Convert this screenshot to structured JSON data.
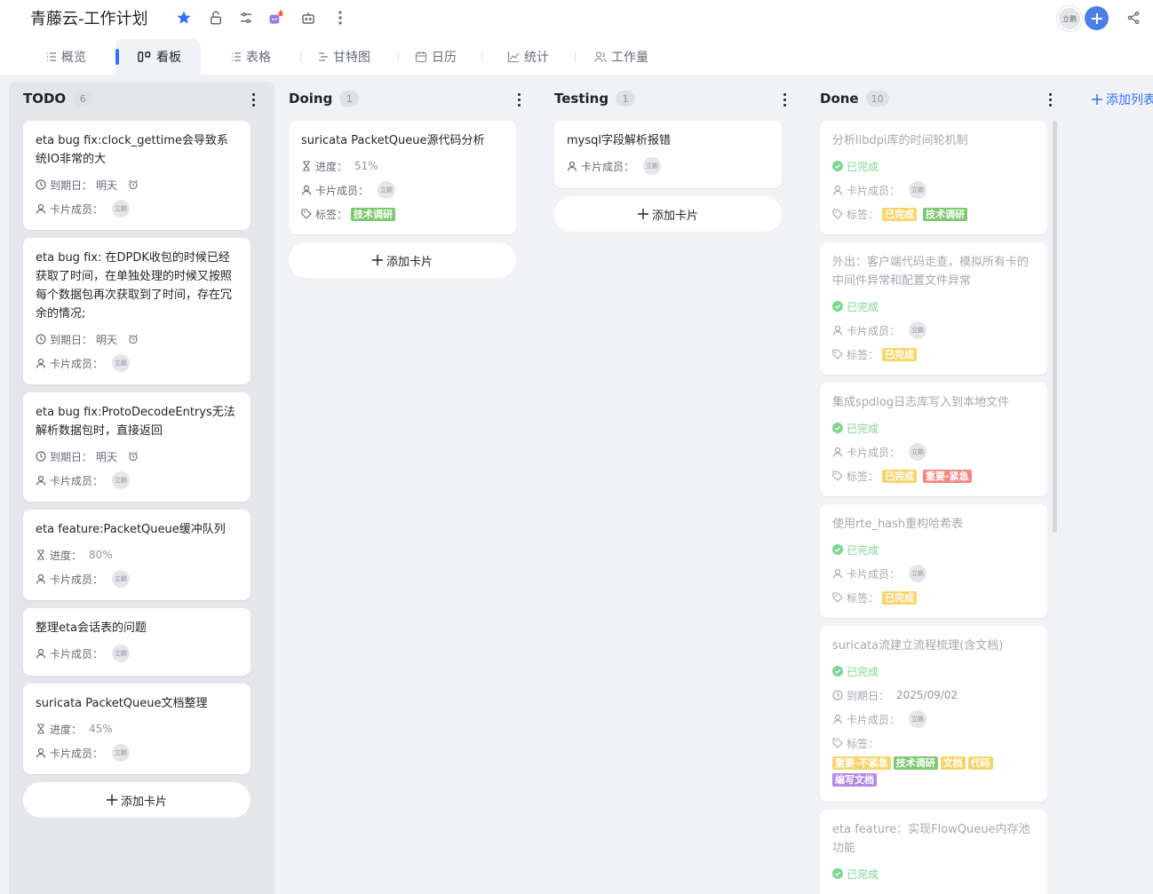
{
  "app": {
    "title": "青藤云-工作计划",
    "header_avatar": "立鹏",
    "accent": "#3370ff"
  },
  "tabs": [
    {
      "label": "概览",
      "icon": "list-icon"
    },
    {
      "label": "看板",
      "icon": "kanban-icon",
      "active": true
    },
    {
      "label": "表格",
      "icon": "list-icon"
    },
    {
      "label": "甘特图",
      "icon": "gantt-icon"
    },
    {
      "label": "日历",
      "icon": "calendar-icon"
    },
    {
      "label": "统计",
      "icon": "chart-icon"
    },
    {
      "label": "工作量",
      "icon": "people-icon"
    }
  ],
  "labels": {
    "due": "到期日：",
    "members": "卡片成员：",
    "progress": "进度：",
    "tags": "标签：",
    "completed": "已完成",
    "add_card": "添加卡片",
    "add_list": "添加列表",
    "tomorrow": "明天",
    "avatar": "立鹏"
  },
  "columns": {
    "todo": {
      "title": "TODO",
      "count": "6",
      "cards": [
        {
          "title": "eta bug fix:clock_gettime会导致系统IO非常的大"
        },
        {
          "title": "eta bug fix: 在DPDK收包的时候已经获取了时间，在单独处理的时候又按照每个数据包再次获取到了时间，存在冗余的情况;"
        },
        {
          "title": "eta bug fix:ProtoDecodeEntrys无法解析数据包时，直接返回"
        },
        {
          "title": "eta feature:PacketQueue缓冲队列",
          "progress": "80%"
        },
        {
          "title": "整理eta会话表的问题"
        },
        {
          "title": "suricata PacketQueue文档整理",
          "progress": "45%"
        }
      ]
    },
    "doing": {
      "title": "Doing",
      "count": "1",
      "cards": [
        {
          "title": "suricata PacketQueue源代码分析",
          "progress": "51%",
          "tags": [
            "技术调研"
          ]
        }
      ]
    },
    "testing": {
      "title": "Testing",
      "count": "1",
      "cards": [
        {
          "title": "mysql字段解析报错"
        }
      ]
    },
    "done": {
      "title": "Done",
      "count": "10",
      "cards": [
        {
          "title": "分析libdpi库的时间轮机制",
          "tags": [
            "已完成",
            "技术调研"
          ]
        },
        {
          "title": "外出：客户端代码走查，模拟所有卡的中间件异常和配置文件异常",
          "tags": [
            "已完成"
          ]
        },
        {
          "title": "集成spdlog日志库写入到本地文件",
          "tags": [
            "已完成",
            "重要-紧急"
          ]
        },
        {
          "title": "使用rte_hash重构哈希表",
          "tags": [
            "已完成"
          ]
        },
        {
          "title": "suricata流建立流程梳理(含文档)",
          "due": "2025/09/02",
          "tags": [
            "重要-不紧急",
            "技术调研",
            "文档",
            "代码",
            "编写文档"
          ]
        },
        {
          "title": "eta feature：实现FlowQueue内存池功能"
        }
      ]
    }
  },
  "tag_colors": {
    "技术调研": "#7ec870",
    "已完成": "#f7d56b",
    "重要-紧急": "#f08a80",
    "重要-不紧急": "#f7d56b",
    "文档": "#f7d56b",
    "代码": "#f7d56b",
    "编写文档": "#b48ae6"
  }
}
